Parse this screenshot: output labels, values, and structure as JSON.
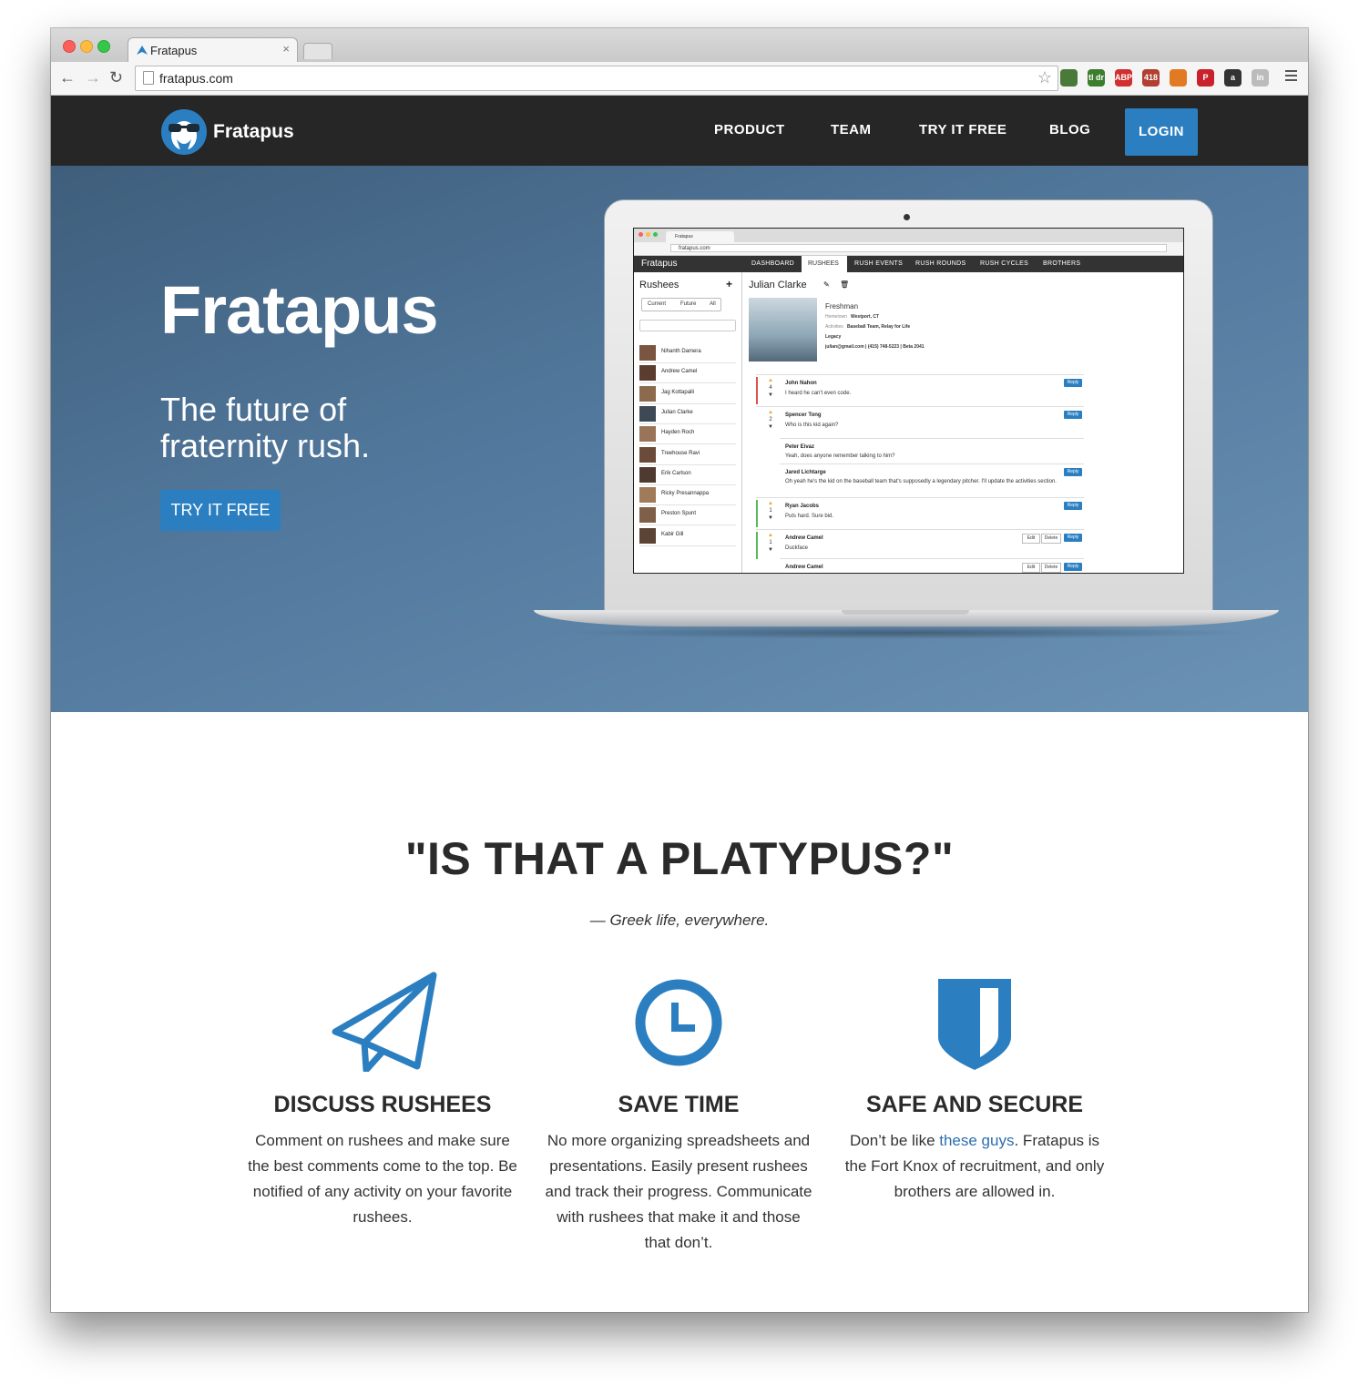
{
  "browser": {
    "tab_title": "Fratapus",
    "tab_close": "×",
    "url": "fratapus.com",
    "back": "←",
    "forward": "→",
    "reload": "↻",
    "star": "☆",
    "extensions": [
      {
        "name": "eyedropper-extension",
        "label": "",
        "color": "#4a7a3a"
      },
      {
        "name": "tldr-extension",
        "label": "tl dr",
        "color": "#3c7d2e"
      },
      {
        "name": "abp-extension",
        "label": "ABP",
        "color": "#d03030"
      },
      {
        "name": "git-extension",
        "label": "418",
        "color": "#b04030"
      },
      {
        "name": "fire-extension",
        "label": "",
        "color": "#e27a24"
      },
      {
        "name": "pinterest-extension",
        "label": "P",
        "color": "#c8232c"
      },
      {
        "name": "amazon-extension",
        "label": "a",
        "color": "#333333"
      },
      {
        "name": "linkedin-extension",
        "label": "in",
        "color": "#bbbbbb"
      }
    ]
  },
  "site": {
    "brand": "Fratapus",
    "nav": {
      "product": "PRODUCT",
      "team": "TEAM",
      "try": "TRY IT FREE",
      "blog": "BLOG",
      "login": "LOGIN"
    },
    "accent": "#2b7fc1"
  },
  "hero": {
    "title": "Fratapus",
    "subtitle": "The future of fraternity rush.",
    "cta": "TRY IT FREE"
  },
  "screen": {
    "tab_title": "Fratapus",
    "url": "fratapus.com",
    "brand": "Fratapus",
    "nav": [
      "DASHBOARD",
      "RUSHEES",
      "RUSH EVENTS",
      "RUSH ROUNDS",
      "RUSH CYCLES",
      "BROTHERS"
    ],
    "sidebar_title": "Rushees",
    "add": "+",
    "filters": [
      "Current",
      "Future",
      "All"
    ],
    "rushees": [
      "Nihanth Damera",
      "Andrew Camel",
      "Jag Kottapalli",
      "Julian Clarke",
      "Hayden Roch",
      "Treehouse Ravi",
      "Erik Carlson",
      "Ricky Presannappa",
      "Preston Spunt",
      "Kabir Gill"
    ],
    "person": {
      "name": "Julian Clarke",
      "year": "Freshman",
      "hometown_label": "Hometown",
      "hometown": "Westport, CT",
      "activities_label": "Activities",
      "activities": "Baseball Team, Relay for Life",
      "legacy": "Legacy",
      "contact": "julian@gmail.com | (415) 748-5223 | Beta 2041"
    },
    "comments": [
      {
        "author": "John Nahon",
        "text": "I heard he can't even code.",
        "votes": "4",
        "bar": "#d9534f",
        "reply": "Reply"
      },
      {
        "author": "Spencer Tong",
        "text": "Who is this kid again?",
        "votes": "2",
        "bar": "#ffffff",
        "reply": "Reply"
      },
      {
        "author": "Peter Eivaz",
        "text": "Yeah, does anyone remember talking to him?",
        "votes": "",
        "bar": "#ffffff",
        "reply": ""
      },
      {
        "author": "Jared Lichtarge",
        "text": "Oh yeah he's the kid on the baseball team that's supposedly a legendary pitcher. I'll update the activities section.",
        "votes": "",
        "bar": "#ffffff",
        "reply": "Reply"
      },
      {
        "author": "Ryan Jacobs",
        "text": "Puts hard. Sure bid.",
        "votes": "1",
        "bar": "#5cb85c",
        "reply": "Reply"
      },
      {
        "author": "Andrew Camel",
        "text": "Duckface",
        "votes": "1",
        "bar": "#5cb85c",
        "reply": "Reply"
      },
      {
        "author": "Andrew Camel",
        "text": "",
        "votes": "",
        "bar": "#ffffff",
        "reply": "Reply"
      }
    ],
    "edit": "Edit",
    "delete": "Delete"
  },
  "quote": {
    "title": "\"IS THAT A PLATYPUS?\"",
    "attribution": "— Greek life, everywhere."
  },
  "features": [
    {
      "icon": "paper-plane-icon",
      "title": "DISCUSS RUSHEES",
      "desc": "Comment on rushees and make sure the best comments come to the top. Be notified of any activity on your favorite rushees."
    },
    {
      "icon": "clock-icon",
      "title": "SAVE TIME",
      "desc": "No more organizing spreadsheets and presentations. Easily present rushees and track their progress. Communicate with rushees that make it and those that don’t."
    },
    {
      "icon": "shield-icon",
      "title": "SAFE AND SECURE",
      "desc_pre": "Don’t be like ",
      "desc_link": "these guys",
      "desc_post": ". Fratapus is the Fort Knox of recruitment, and only brothers are allowed in."
    }
  ]
}
